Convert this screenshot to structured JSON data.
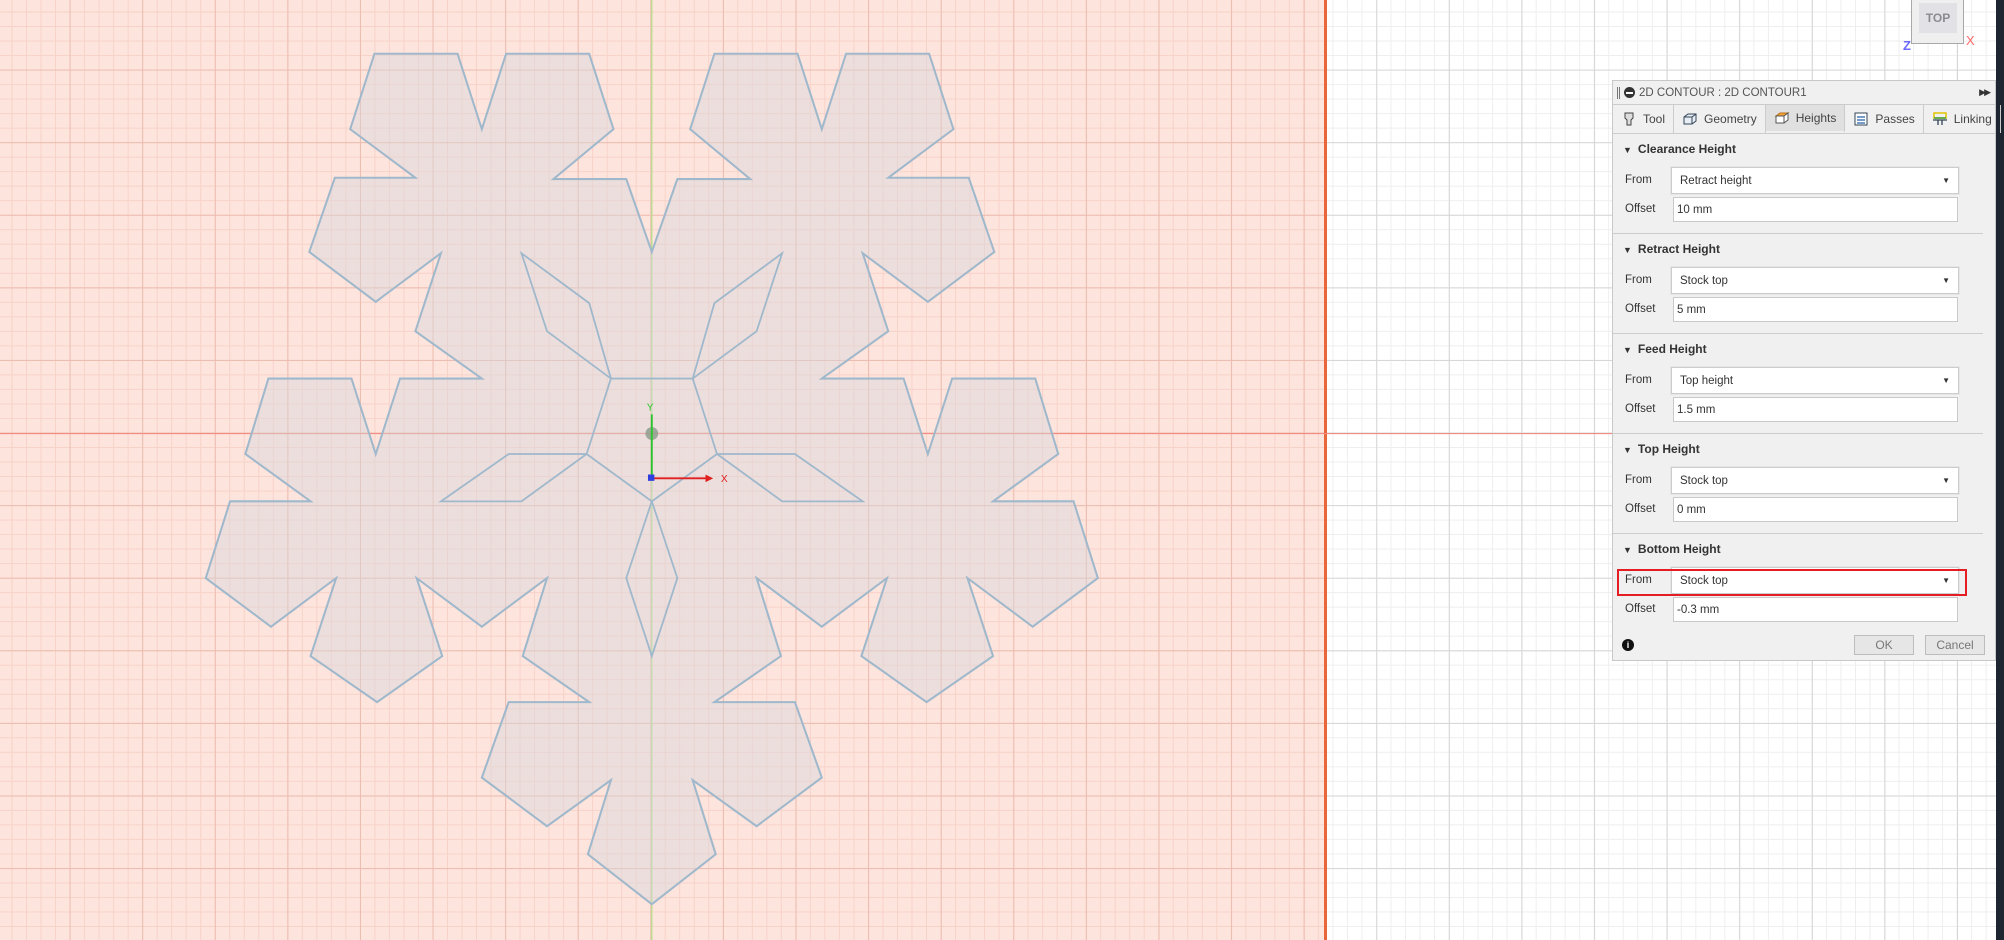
{
  "viewcube": {
    "face": "TOP",
    "z_label": "Z",
    "x_label": "X"
  },
  "axes": {
    "x_label": "X",
    "y_label": "Y"
  },
  "panel": {
    "title": "2D CONTOUR : 2D CONTOUR1",
    "tabs": [
      {
        "label": "Tool",
        "icon": "tool-icon"
      },
      {
        "label": "Geometry",
        "icon": "geometry-icon"
      },
      {
        "label": "Heights",
        "icon": "heights-icon",
        "active": true
      },
      {
        "label": "Passes",
        "icon": "passes-icon"
      },
      {
        "label": "Linking",
        "icon": "linking-icon"
      }
    ],
    "from_label": "From",
    "offset_label": "Offset",
    "sections": [
      {
        "title": "Clearance Height",
        "from": "Retract height",
        "offset": "10 mm"
      },
      {
        "title": "Retract Height",
        "from": "Stock top",
        "offset": "5 mm"
      },
      {
        "title": "Feed Height",
        "from": "Top height",
        "offset": "1.5 mm"
      },
      {
        "title": "Top Height",
        "from": "Stock top",
        "offset": "0 mm"
      },
      {
        "title": "Bottom Height",
        "from": "Stock top",
        "offset": "-0.3 mm",
        "highlighted": true
      }
    ],
    "ok_label": "OK",
    "cancel_label": "Cancel"
  },
  "colors": {
    "stock": "#fde4dd",
    "stock_border": "#e8663a",
    "highlight": "#e41c24",
    "profile": "#9fb8cc"
  }
}
